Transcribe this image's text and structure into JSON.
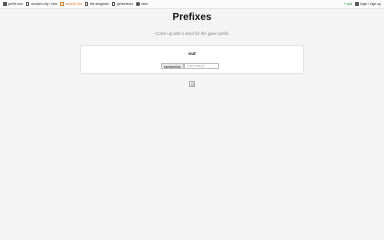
{
  "topbar": {
    "nav": [
      {
        "label": "prefix.one",
        "icon": "logo-icon"
      },
      {
        "label": "random.city / new",
        "icon": "dice-icon"
      },
      {
        "label": "sorted / list",
        "icon": "list-icon",
        "active": true
      },
      {
        "label": "the anagram",
        "icon": "anagram-icon"
      },
      {
        "label": "generators",
        "icon": "generator-icon"
      },
      {
        "label": "view",
        "icon": "eye-icon"
      }
    ],
    "add_label": "+ add",
    "login_label": "login / sign up"
  },
  "page": {
    "title": "Prefixes",
    "subtitle": "Come up with a word for the given prefix"
  },
  "card": {
    "out_label": "out",
    "randomize_label": "randomize",
    "count_placeholder": "how many?"
  },
  "colors": {
    "accent": "#e07a2b",
    "add": "#2a9a3a",
    "background": "#f4f4f4"
  }
}
